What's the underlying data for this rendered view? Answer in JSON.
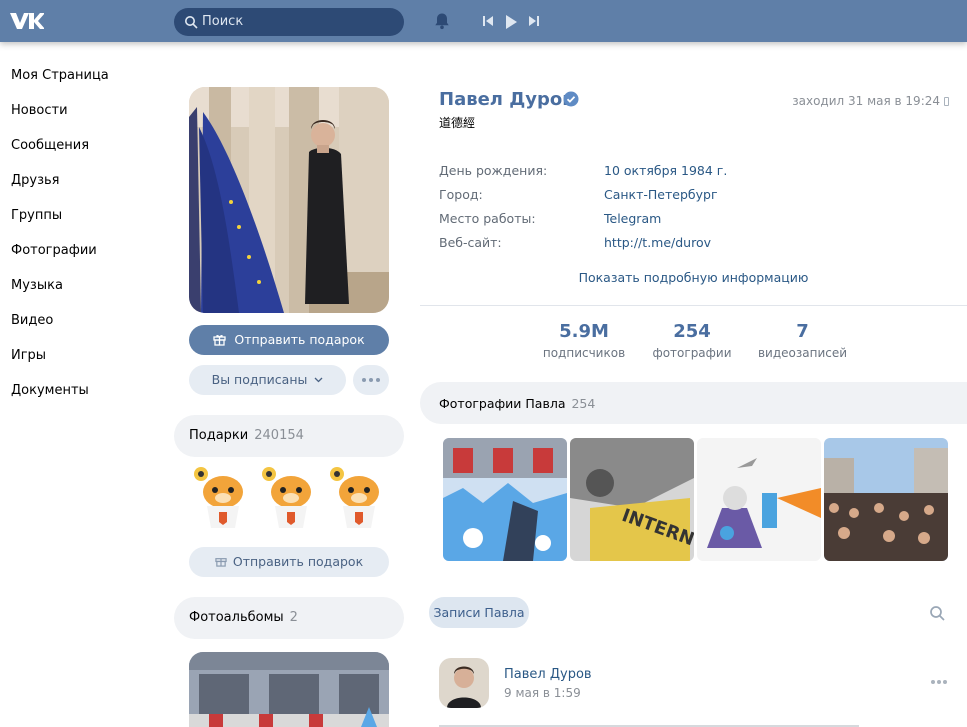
{
  "header": {
    "logo": "VK",
    "search_placeholder": "Поиск",
    "icons": [
      "vk-logo",
      "search-icon",
      "bell-icon",
      "prev-icon",
      "play-icon",
      "next-icon"
    ]
  },
  "sidebar": {
    "items": [
      {
        "label": "Моя Страница"
      },
      {
        "label": "Новости"
      },
      {
        "label": "Сообщения"
      },
      {
        "label": "Друзья"
      },
      {
        "label": "Группы"
      },
      {
        "label": "Фотографии"
      },
      {
        "label": "Музыка"
      },
      {
        "label": "Видео"
      },
      {
        "label": "Игры"
      },
      {
        "label": "Документы"
      }
    ]
  },
  "profile": {
    "name": "Павел Дуров",
    "status": "道德經",
    "last_seen": "заходил 31 мая в 19:24",
    "info": [
      {
        "key": "День рождения:",
        "value": "10 октября 1984 г."
      },
      {
        "key": "Город:",
        "value": "Санкт-Петербург"
      },
      {
        "key": "Место работы:",
        "value": "Telegram"
      },
      {
        "key": "Веб-сайт:",
        "value": "http://t.me/durov"
      }
    ],
    "show_more": "Показать подробную информацию",
    "stats": [
      {
        "number": "5.9M",
        "label": "подписчиков"
      },
      {
        "number": "254",
        "label": "фотографии"
      },
      {
        "number": "7",
        "label": "видеозаписей"
      }
    ]
  },
  "left_column": {
    "send_gift": "Отправить подарок",
    "subscribed": "Вы подписаны",
    "gifts_title": "Подарки",
    "gifts_count": "240154",
    "send_gift_2": "Отправить подарок",
    "albums_title": "Фотоальбомы",
    "albums_count": "2"
  },
  "photos": {
    "title": "Фотографии Павла",
    "count": "254"
  },
  "posts": {
    "tab": "Записи Павла",
    "author": "Павел Дуров",
    "date": "9 мая в 1:59"
  },
  "colors": {
    "header": "#5f7fa8",
    "link": "#2a5885",
    "name": "#4a6ea0"
  }
}
